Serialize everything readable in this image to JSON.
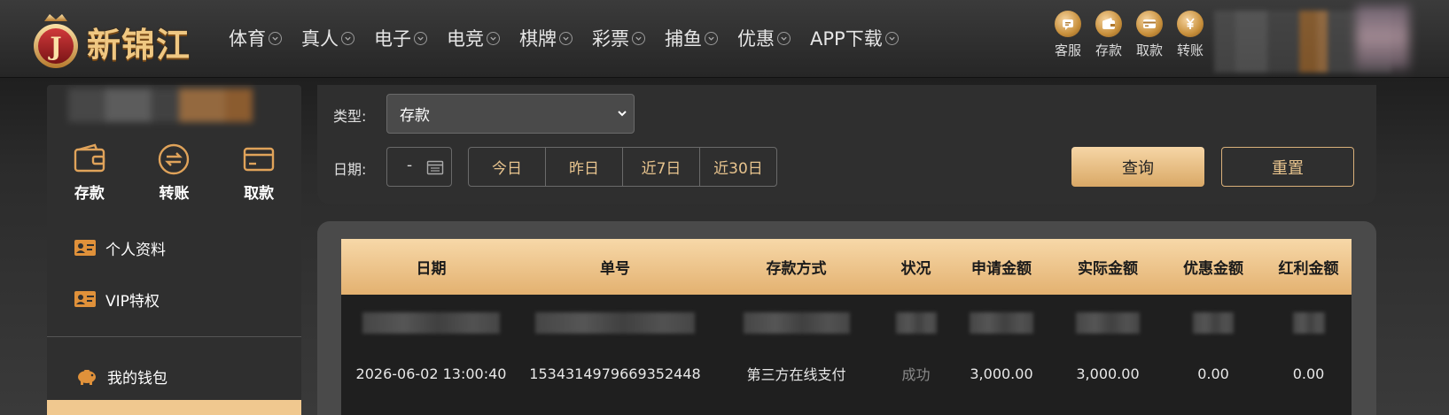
{
  "brand": {
    "name": "新锦江",
    "badge_letter": "J"
  },
  "nav": [
    {
      "label": "体育"
    },
    {
      "label": "真人"
    },
    {
      "label": "电子"
    },
    {
      "label": "电竞"
    },
    {
      "label": "棋牌"
    },
    {
      "label": "彩票"
    },
    {
      "label": "捕鱼"
    },
    {
      "label": "优惠"
    },
    {
      "label": "APP下载"
    }
  ],
  "quick_actions": [
    {
      "label": "客服",
      "icon": "chat-icon"
    },
    {
      "label": "存款",
      "icon": "wallet-icon"
    },
    {
      "label": "取款",
      "icon": "card-icon"
    },
    {
      "label": "转账",
      "icon": "yuan-icon"
    }
  ],
  "sidebar": {
    "actions": [
      {
        "label": "存款",
        "icon": "wallet-icon"
      },
      {
        "label": "转账",
        "icon": "transfer-icon"
      },
      {
        "label": "取款",
        "icon": "card-icon"
      }
    ],
    "menu": [
      {
        "label": "个人资料",
        "icon": "id-card-icon"
      },
      {
        "label": "VIP特权",
        "icon": "vip-card-icon"
      }
    ],
    "wallet_label": "我的钱包"
  },
  "filter": {
    "type_label": "类型:",
    "type_value": "存款",
    "date_label": "日期:",
    "date_placeholder": "-",
    "ranges": [
      "今日",
      "昨日",
      "近7日",
      "近30日"
    ],
    "query_label": "查询",
    "reset_label": "重置"
  },
  "table": {
    "headers": [
      "日期",
      "单号",
      "存款方式",
      "状况",
      "申请金额",
      "实际金额",
      "优惠金额",
      "红利金额"
    ],
    "rows": [
      {
        "date": "2026-06-02 13:00:40",
        "order_no": "1534314979669352448",
        "method": "第三方在线支付",
        "status": "成功",
        "applied": "3,000.00",
        "actual": "3,000.00",
        "promo": "0.00",
        "bonus": "0.00"
      }
    ]
  },
  "colors": {
    "accent": "#e8c48e",
    "header_gold": "#f0c882",
    "panel": "#2f2f2f"
  }
}
